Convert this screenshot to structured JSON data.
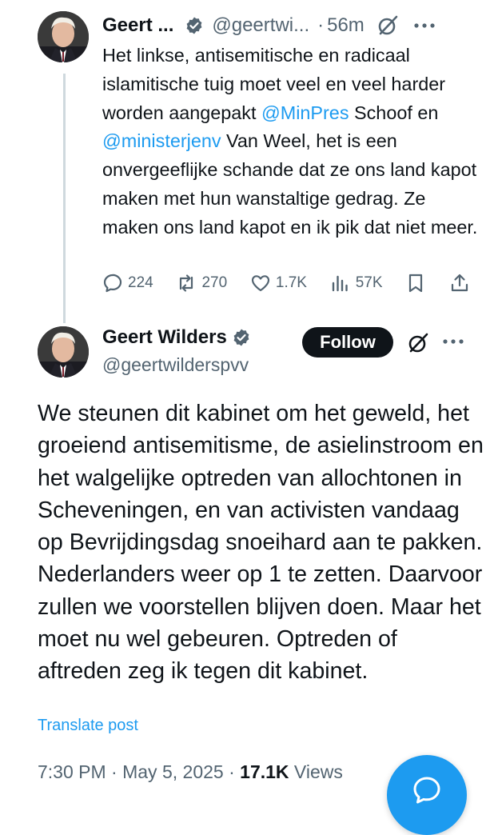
{
  "first_post": {
    "author_name": "Geert ...",
    "handle": "@geertwi...",
    "separator": "·",
    "time_ago": "56m",
    "body_parts": [
      {
        "text": "Het linkse, antisemitische en radicaal islamitische tuig moet veel en veel harder worden aangepakt ",
        "link": false
      },
      {
        "text": "@MinPres",
        "link": true
      },
      {
        "text": " Schoof en ",
        "link": false
      },
      {
        "text": "@ministerjenv",
        "link": true
      },
      {
        "text": " Van Weel, het is een onvergeeflijke schande dat ze ons land kapot maken met hun wanstaltige gedrag. Ze maken ons land kapot en ik pik dat niet meer.",
        "link": false
      }
    ],
    "stats": {
      "replies": "224",
      "reposts": "270",
      "likes": "1.7K",
      "views": "57K"
    }
  },
  "main_post": {
    "author_name": "Geert Wilders",
    "handle": "@geertwilderspvv",
    "follow_label": "Follow",
    "body": "We steunen dit kabinet om het geweld, het groeiend antisemitisme, de asielinstroom en het walgelijke optreden van allochtonen in Scheveningen, en van activisten vandaag op Bevrijdingsdag snoeihard aan te pakken. Nederlanders weer op 1 te zetten. Daarvoor zullen we voorstellen blijven doen. Maar het moet nu wel gebeuren. Optreden of aftreden zeg ik tegen dit kabinet.",
    "translate_label": "Translate post",
    "time": "7:30 PM",
    "dot": "·",
    "date": "May 5, 2025",
    "views_count": "17.1K",
    "views_label": "Views"
  },
  "colors": {
    "link": "#1d9bf0",
    "text": "#0f1419",
    "muted": "#536471",
    "follow_bg": "#0f1419",
    "fab": "#1d9bf0",
    "thread_line": "#cfd9de"
  },
  "icons": [
    "verified-badge-icon",
    "grok-icon",
    "more-icon",
    "reply-icon",
    "repost-icon",
    "like-icon",
    "views-icon",
    "bookmark-icon",
    "share-icon",
    "compose-icon"
  ]
}
